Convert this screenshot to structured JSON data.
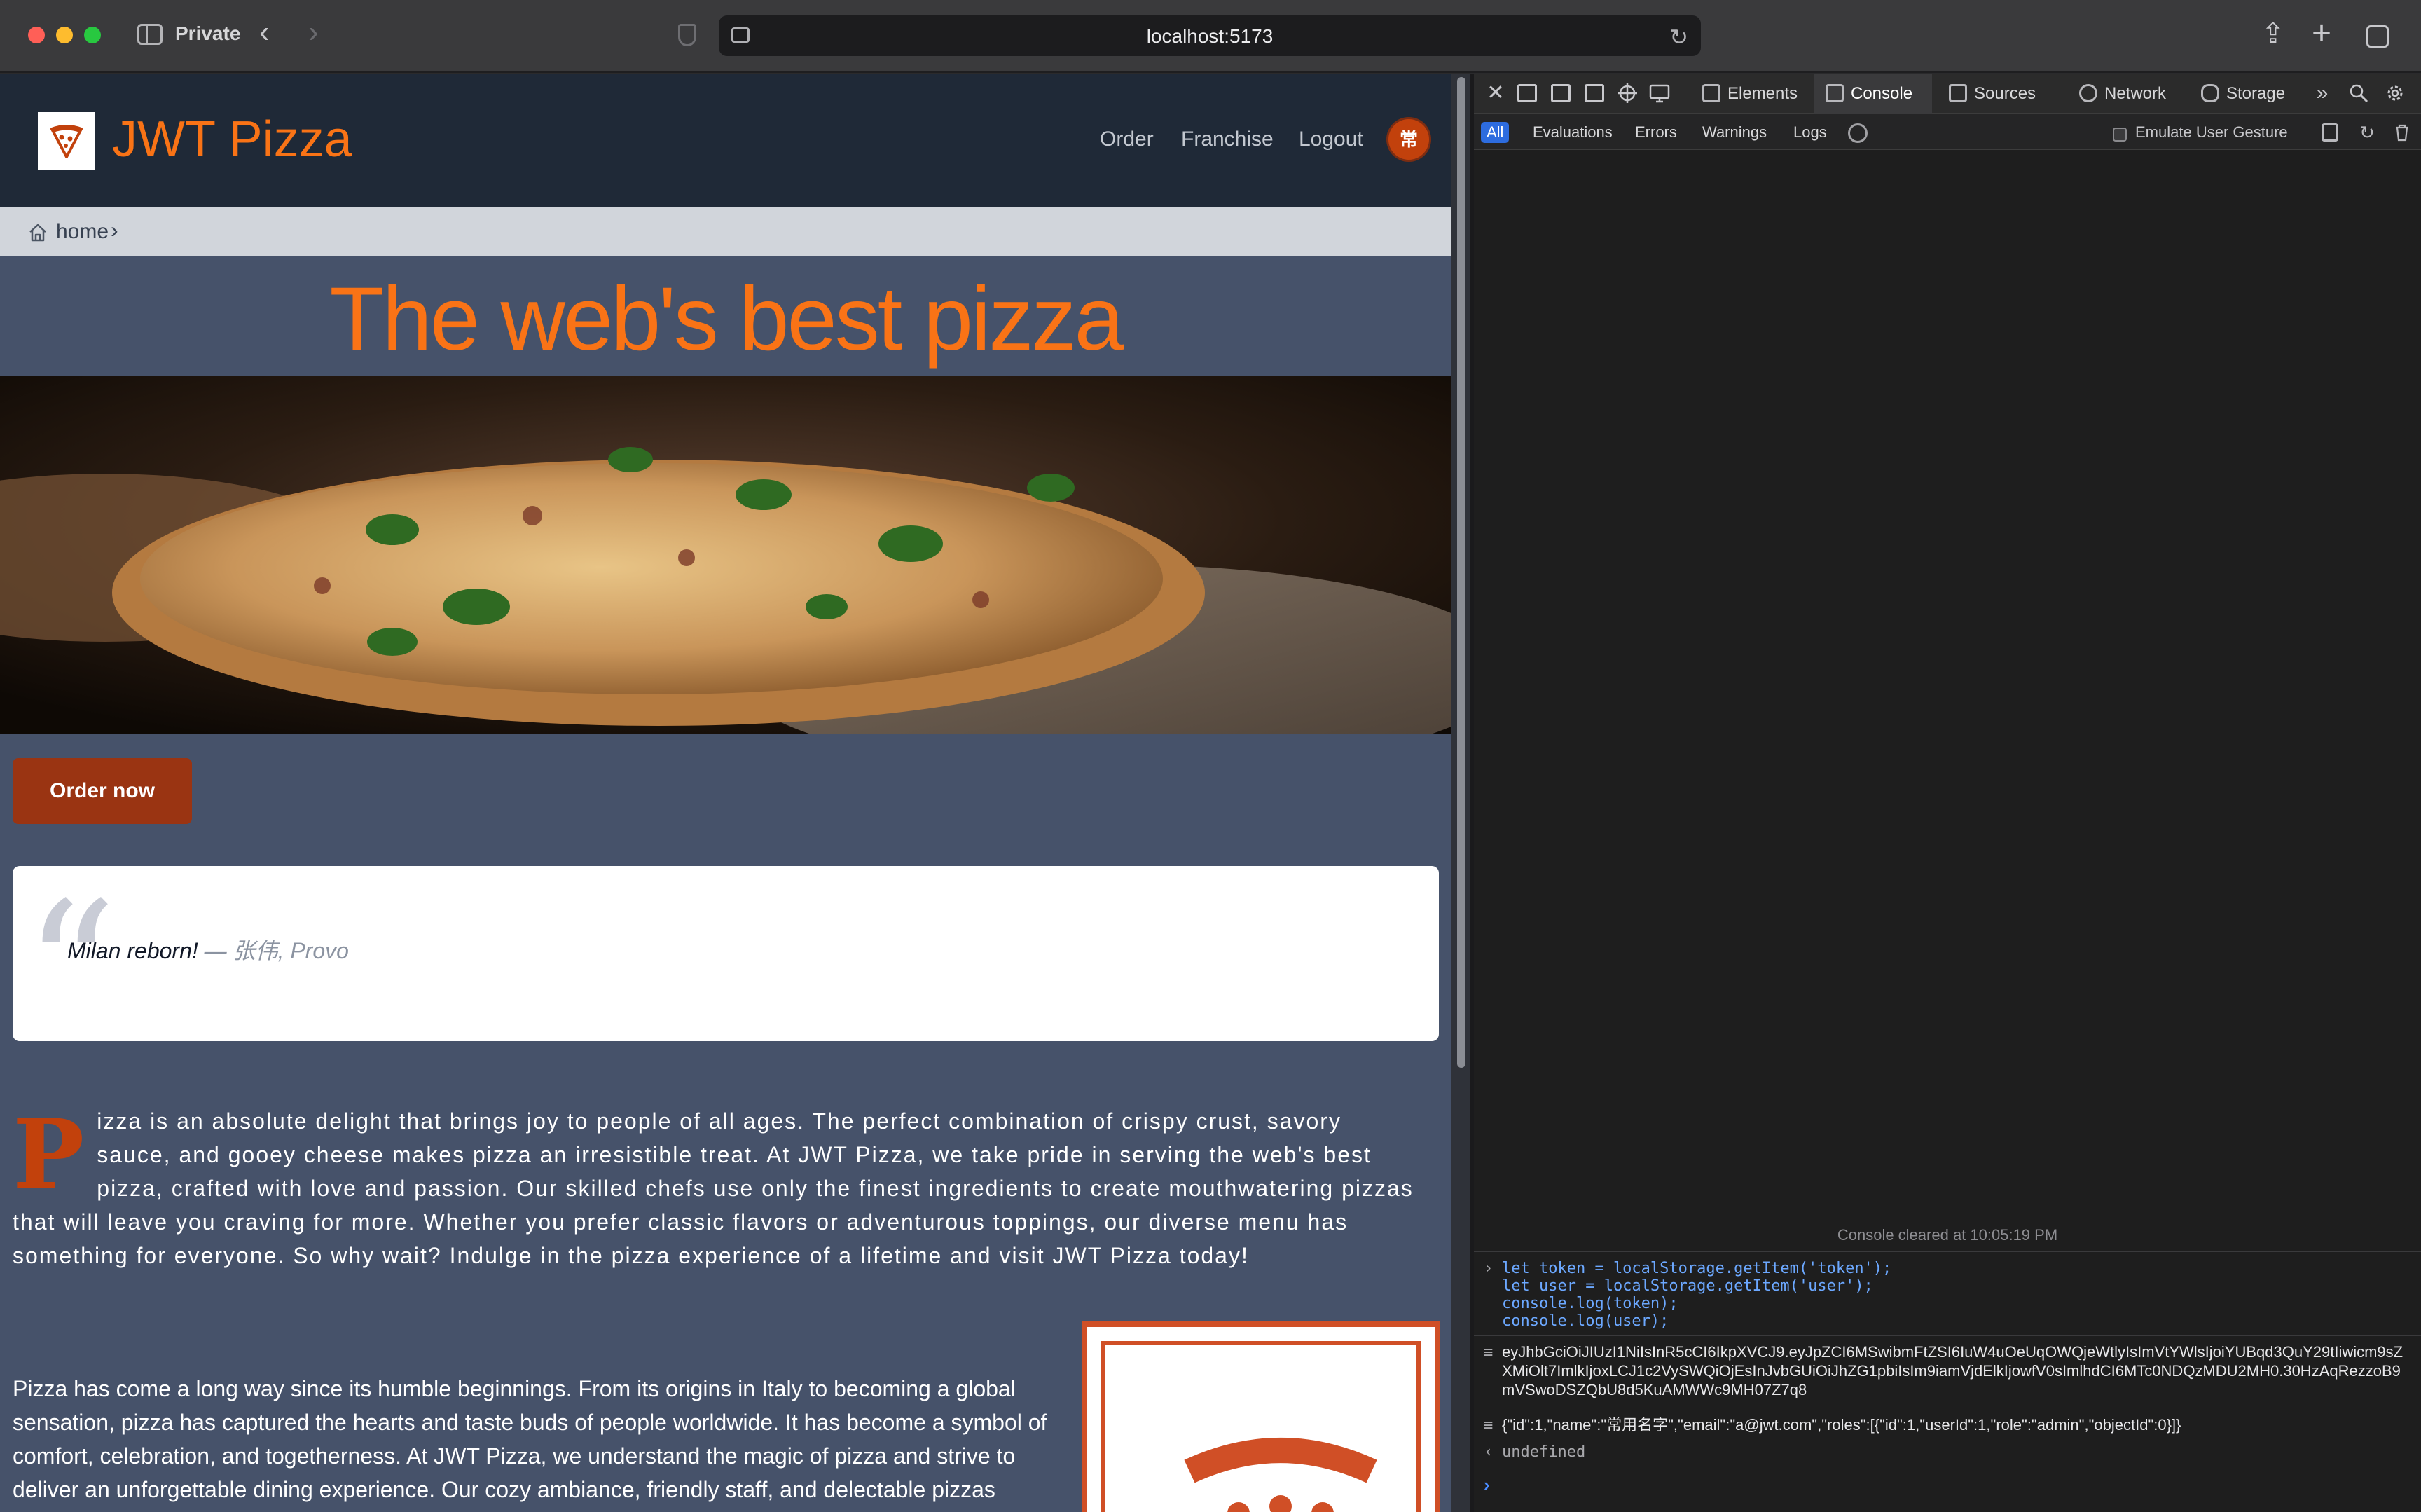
{
  "browser": {
    "window_label": "Private",
    "url": "localhost:5173",
    "back_glyph": "‹",
    "forward_glyph": "›",
    "reload_glyph": "↻",
    "share_glyph": "⇪",
    "new_tab_glyph": "+",
    "icons": [
      "sidebar-icon",
      "shield-icon",
      "page-icon",
      "reload-icon",
      "share-icon",
      "plus-icon",
      "tabs-icon"
    ]
  },
  "site": {
    "title": "JWT Pizza",
    "nav": {
      "order": "Order",
      "franchise": "Franchise",
      "logout": "Logout"
    },
    "avatar_text": "常",
    "breadcrumb": {
      "home": "home",
      "chevron": "›"
    },
    "hero_title": "The web's best pizza",
    "order_button": "Order now",
    "quote": {
      "mark": "“",
      "text": "Milan reborn!",
      "author": " — 张伟, Provo"
    },
    "para1_dropcap": "P",
    "para1_rest": "izza is an absolute delight that brings joy to people of all ages. The perfect combination of crispy crust, savory sauce, and gooey cheese makes pizza an irresistible treat. At JWT Pizza, we take pride in serving the web's best pizza, crafted with love and passion. Our skilled chefs use only the finest ingredients to create mouthwatering pizzas that will leave you craving for more. Whether you prefer classic flavors or adventurous toppings, our diverse menu has something for everyone. So why wait? Indulge in the pizza experience of a lifetime and visit JWT Pizza today!",
    "para2": "Pizza has come a long way since its humble beginnings. From its origins in Italy to becoming a global sensation, pizza has captured the hearts and taste buds of people worldwide. It has become a symbol of comfort, celebration, and togetherness. At JWT Pizza, we understand the magic of pizza and strive to deliver an unforgettable dining experience. Our cozy ambiance, friendly staff, and delectable pizzas create the perfect setting for a memorable meal. Whether you're dining with family, friends, or enjoying a solo pizza night, Pizza Shop is the place to be.",
    "accent_color": "#f97316",
    "header_color": "#1f2937"
  },
  "devtools": {
    "tabs": {
      "elements": "Elements",
      "console": "Console",
      "sources": "Sources",
      "network": "Network",
      "storage": "Storage"
    },
    "active_tab": "Console",
    "filters": {
      "all": "All",
      "evaluations": "Evaluations",
      "errors": "Errors",
      "warnings": "Warnings",
      "logs": "Logs"
    },
    "emulate_label": "Emulate User Gesture",
    "close_glyph": "✕",
    "more_glyph": "»",
    "console": {
      "cleared": "Console cleared at 10:05:19 PM",
      "input": "let token = localStorage.getItem('token');\nlet user = localStorage.getItem('user');\nconsole.log(token);\nconsole.log(user);",
      "token_output": "eyJhbGciOiJIUzI1NiIsInR5cCI6IkpXVCJ9.eyJpZCI6MSwibmFtZSI6IuW4uOeUqOWQjeWtlyIsImVtYWlsIjoiYUBqd3QuY29tIiwicm9sZXMiOlt7ImlkIjoxLCJ1c2VySWQiOjEsInJvbGUiOiJhZG1pbiIsIm9iamVjdElkIjowfV0sImlhdCI6MTc0NDQzMDU2MH0.30HzAqRezzoB9mVSwoDSZQbU8d5KuAMWWc9MH07Z7q8",
      "user_output": "{\"id\":1,\"name\":\"常用名字\",\"email\":\"a@jwt.com\",\"roles\":[{\"id\":1,\"userId\":1,\"role\":\"admin\",\"objectId\":0}]}",
      "result": "undefined",
      "input_marker": "›",
      "output_marker": "≡",
      "result_marker": "‹",
      "prompt": "›"
    }
  }
}
